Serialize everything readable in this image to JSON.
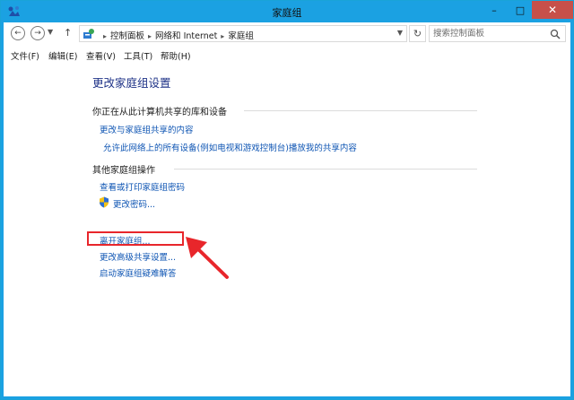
{
  "window": {
    "title": "家庭组",
    "minimize": "–",
    "maximize": "□",
    "close": "✕"
  },
  "address": {
    "crumbs": [
      "控制面板",
      "网络和 Internet",
      "家庭组"
    ],
    "search_placeholder": "搜索控制面板"
  },
  "menu": [
    "文件(F)",
    "编辑(E)",
    "查看(V)",
    "工具(T)",
    "帮助(H)"
  ],
  "page": {
    "title": "更改家庭组设置",
    "section1": {
      "title": "你正在从此计算机共享的库和设备",
      "links": [
        "更改与家庭组共享的内容",
        "允许此网络上的所有设备(例如电视和游戏控制台)播放我的共享内容"
      ]
    },
    "section2": {
      "title": "其他家庭组操作",
      "links": [
        "查看或打印家庭组密码",
        "更改密码...",
        "离开家庭组...",
        "更改高级共享设置...",
        "启动家庭组疑难解答"
      ]
    }
  },
  "colors": {
    "titlebar": "#1ba1e2",
    "link": "#0d54b3",
    "highlight": "#e8262b"
  }
}
